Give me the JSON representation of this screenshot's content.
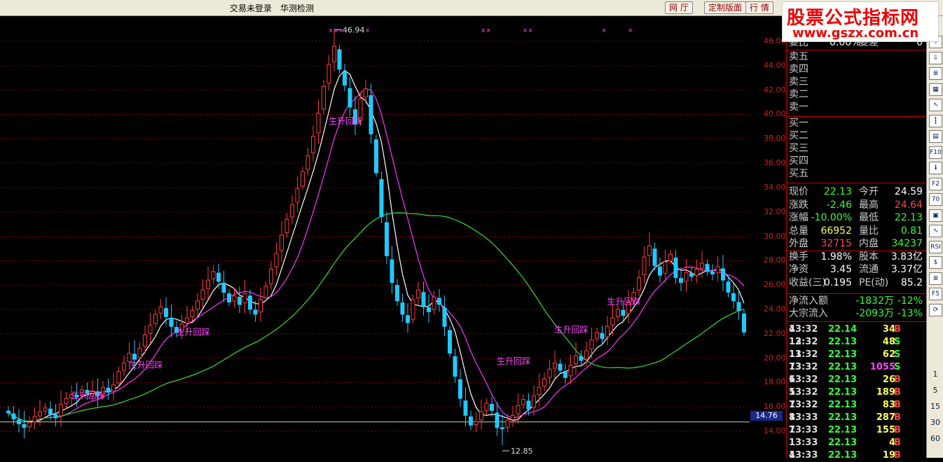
{
  "menu": {
    "status": "交易未登录",
    "monitor": "华测检测"
  },
  "toolbar": {
    "net": "网 厅",
    "custom": "定制版面",
    "quote": "行 情"
  },
  "watermark": {
    "line1": "股票公式指标网",
    "line2": "www.gszx.com.cn"
  },
  "colors": {
    "up": "#ff3b3b",
    "down": "#1fc9ff",
    "ma_short": "#ffffff",
    "ma_mid": "#ff33ff",
    "ma_long": "#33dd33",
    "grid": "#8a0000",
    "signal": "#ff44ff"
  },
  "chart_data": {
    "type": "candlestick",
    "ylim": [
      13,
      47
    ],
    "yticks": [
      "46.00",
      "44.00",
      "42.00",
      "40.00",
      "38.00",
      "36.00",
      "34.00",
      "32.00",
      "30.00",
      "28.00",
      "26.00",
      "24.00",
      "22.00",
      "20.00",
      "18.00",
      "16.00",
      "14.00"
    ],
    "current_price": "14.76",
    "current_price_value": 14.76,
    "high_label": "46.94",
    "low_label": "12.85",
    "high_value": 46.94,
    "low_value": 12.85,
    "signal_text": "生升回踩",
    "signals": [
      {
        "bar": 13,
        "price": 17.0
      },
      {
        "bar": 24,
        "price": 19.5
      },
      {
        "bar": 33,
        "price": 22.2
      },
      {
        "bar": 62,
        "price": 39.5
      },
      {
        "bar": 94,
        "price": 19.8
      },
      {
        "bar": 105,
        "price": 22.4
      },
      {
        "bar": 115,
        "price": 24.7
      }
    ],
    "markers": "x",
    "marker_bars": [
      61,
      62,
      63,
      68,
      90,
      91,
      98,
      99,
      113,
      118
    ],
    "closes": [
      15.5,
      15.0,
      14.6,
      14.3,
      14.7,
      15.2,
      15.6,
      15.9,
      15.4,
      15.1,
      16.2,
      16.7,
      17.0,
      16.8,
      17.4,
      17.1,
      17.3,
      16.9,
      17.6,
      17.2,
      17.8,
      18.9,
      19.6,
      20.4,
      19.9,
      20.8,
      21.9,
      22.7,
      23.6,
      24.2,
      23.4,
      22.6,
      22.1,
      22.8,
      23.3,
      23.9,
      24.7,
      25.6,
      26.4,
      27.1,
      26.3,
      25.4,
      24.6,
      25.1,
      24.4,
      25.3,
      24.0,
      23.6,
      24.8,
      25.9,
      27.3,
      28.6,
      30.1,
      31.4,
      32.6,
      33.9,
      35.3,
      36.6,
      38.2,
      40.1,
      42.3,
      44.1,
      45.6,
      43.7,
      42.4,
      40.6,
      39.2,
      41.3,
      42.1,
      38.4,
      35.2,
      31.6,
      28.4,
      26.2,
      24.7,
      23.6,
      22.9,
      24.8,
      25.6,
      24.2,
      23.8,
      25.0,
      24.4,
      22.6,
      20.4,
      18.5,
      16.7,
      15.3,
      14.5,
      14.8,
      15.6,
      16.3,
      15.7,
      14.3,
      14.2,
      14.9,
      15.3,
      16.1,
      16.6,
      15.8,
      16.9,
      17.6,
      18.3,
      19.1,
      19.6,
      19.0,
      18.4,
      19.4,
      20.2,
      19.8,
      20.6,
      21.5,
      22.1,
      21.6,
      22.6,
      23.3,
      24.0,
      23.5,
      24.6,
      25.4,
      26.6,
      28.3,
      29.2,
      27.6,
      26.8,
      27.9,
      28.5,
      26.6,
      26.2,
      27.0,
      26.7,
      27.3,
      27.8,
      27.1,
      26.9,
      27.5,
      26.4,
      25.4,
      24.7,
      23.9,
      22.13
    ]
  },
  "quote": {
    "wei": [
      "委比",
      "0.00%",
      "委差",
      "0"
    ],
    "sells": [
      "卖五",
      "卖四",
      "卖三",
      "卖二",
      "卖一"
    ],
    "buys": [
      "买一",
      "买二",
      "买三",
      "买四",
      "买五"
    ],
    "rows": [
      {
        "k1": "现价",
        "v1": "22.13",
        "c1": "#33ff33",
        "k2": "今开",
        "v2": "24.59",
        "c2": "#ffffff"
      },
      {
        "k1": "涨跌",
        "v1": "-2.46",
        "c1": "#33ff33",
        "k2": "最高",
        "v2": "24.64",
        "c2": "#ff4444"
      },
      {
        "k1": "涨幅",
        "v1": "-10.00%",
        "c1": "#33ff33",
        "k2": "最低",
        "v2": "22.13",
        "c2": "#33ff33"
      },
      {
        "k1": "总量",
        "v1": "66952",
        "c1": "#ffff55",
        "k2": "量比",
        "v2": "0.81",
        "c2": "#33ff33"
      },
      {
        "k1": "外盘",
        "v1": "32715",
        "c1": "#ff4444",
        "k2": "内盘",
        "v2": "34237",
        "c2": "#33ff33"
      },
      {
        "k1": "换手",
        "v1": "1.98%",
        "c1": "#ffffff",
        "k2": "股本",
        "v2": "3.83亿",
        "c2": "#ffffff"
      },
      {
        "k1": "净资",
        "v1": "3.45",
        "c1": "#ffffff",
        "k2": "流通",
        "v2": "3.37亿",
        "c2": "#ffffff"
      },
      {
        "k1": "收益(三)",
        "v1": "0.195",
        "c1": "#ffffff",
        "k2": "PE(动)",
        "v2": "85.2",
        "c2": "#ffffff"
      }
    ],
    "flow": [
      {
        "k": "净流入额",
        "v": "-1832万",
        "p": "-12%"
      },
      {
        "k": "大宗流入",
        "v": "-2093万",
        "p": "-13%"
      }
    ],
    "ticks": [
      {
        "t": "13:32",
        "p": "22.14",
        "v": "34",
        "s": "B",
        "n": "4"
      },
      {
        "t": "13:32",
        "p": "22.13",
        "v": "48",
        "s": "S",
        "n": "12"
      },
      {
        "t": "13:32",
        "p": "22.13",
        "v": "62",
        "s": "S",
        "n": "11"
      },
      {
        "t": "13:32",
        "p": "22.13",
        "v": "1055",
        "s": "S",
        "n": "73"
      },
      {
        "t": "13:32",
        "p": "22.13",
        "v": "26",
        "s": "B",
        "n": "6"
      },
      {
        "t": "13:32",
        "p": "22.13",
        "v": "189",
        "s": "B",
        "n": "5"
      },
      {
        "t": "13:32",
        "p": "22.13",
        "v": "83",
        "s": "B",
        "n": "7"
      },
      {
        "t": "13:33",
        "p": "22.13",
        "v": "287",
        "s": "B",
        "n": "8"
      },
      {
        "t": "13:33",
        "p": "22.13",
        "v": "155",
        "s": "B",
        "n": "7"
      },
      {
        "t": "13:33",
        "p": "22.13",
        "v": "4",
        "s": "B",
        "n": "1"
      },
      {
        "t": "13:33",
        "p": "22.13",
        "v": "19",
        "s": "B",
        "n": "4"
      }
    ]
  },
  "sidebar_icons": [
    {
      "label": "⇧",
      "name": "arrow-up-icon"
    },
    {
      "label": "⇩",
      "name": "arrow-down-icon"
    },
    {
      "label": "≣",
      "name": "report-icon"
    },
    {
      "label": "▦",
      "name": "table-icon"
    },
    {
      "label": "∿",
      "name": "line-chart-icon"
    },
    {
      "label": "┇",
      "name": "candle-icon"
    },
    {
      "label": "▤",
      "name": "list-icon"
    },
    {
      "label": "F10",
      "name": "f10-icon"
    },
    {
      "label": "ℹ",
      "name": "info-icon"
    },
    {
      "label": "F2",
      "name": "f2-icon"
    },
    {
      "label": "70",
      "name": "speed-icon"
    },
    {
      "label": "▣",
      "name": "window-icon"
    },
    {
      "label": "∿",
      "name": "wave-icon"
    },
    {
      "label": "RSI",
      "name": "rsi-icon"
    },
    {
      "label": "$",
      "name": "dollar-icon"
    },
    {
      "label": "≣",
      "name": "sheet-icon"
    },
    {
      "label": "F5",
      "name": "f5-icon"
    },
    {
      "label": "⟳",
      "name": "refresh-icon"
    }
  ],
  "periods": [
    "1",
    "5",
    "15",
    "30",
    "60"
  ]
}
